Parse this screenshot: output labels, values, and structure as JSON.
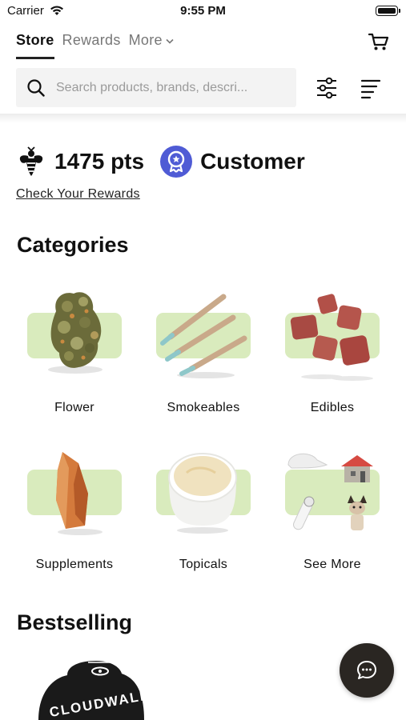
{
  "status_bar": {
    "carrier": "Carrier",
    "time": "9:55 PM"
  },
  "tabs": [
    {
      "label": "Store",
      "active": true
    },
    {
      "label": "Rewards",
      "active": false
    },
    {
      "label": "More",
      "active": false
    }
  ],
  "search": {
    "placeholder": "Search products, brands, descri..."
  },
  "rewards": {
    "points": "1475 pts",
    "tier": "Customer",
    "link": "Check Your Rewards"
  },
  "categories": {
    "title": "Categories",
    "items": [
      {
        "label": "Flower",
        "icon": "flower-image"
      },
      {
        "label": "Smokeables",
        "icon": "smokeables-image"
      },
      {
        "label": "Edibles",
        "icon": "edibles-image"
      },
      {
        "label": "Supplements",
        "icon": "supplements-image"
      },
      {
        "label": "Topicals",
        "icon": "topicals-image"
      },
      {
        "label": "See More",
        "icon": "see-more-image"
      }
    ]
  },
  "bestselling": {
    "title": "Bestselling",
    "brand_logo_text": "CLOUDWALKER"
  },
  "colors": {
    "category_bg": "#d9ebbd",
    "tier_badge": "#4f5bd5",
    "chat_button": "#2a2622"
  }
}
